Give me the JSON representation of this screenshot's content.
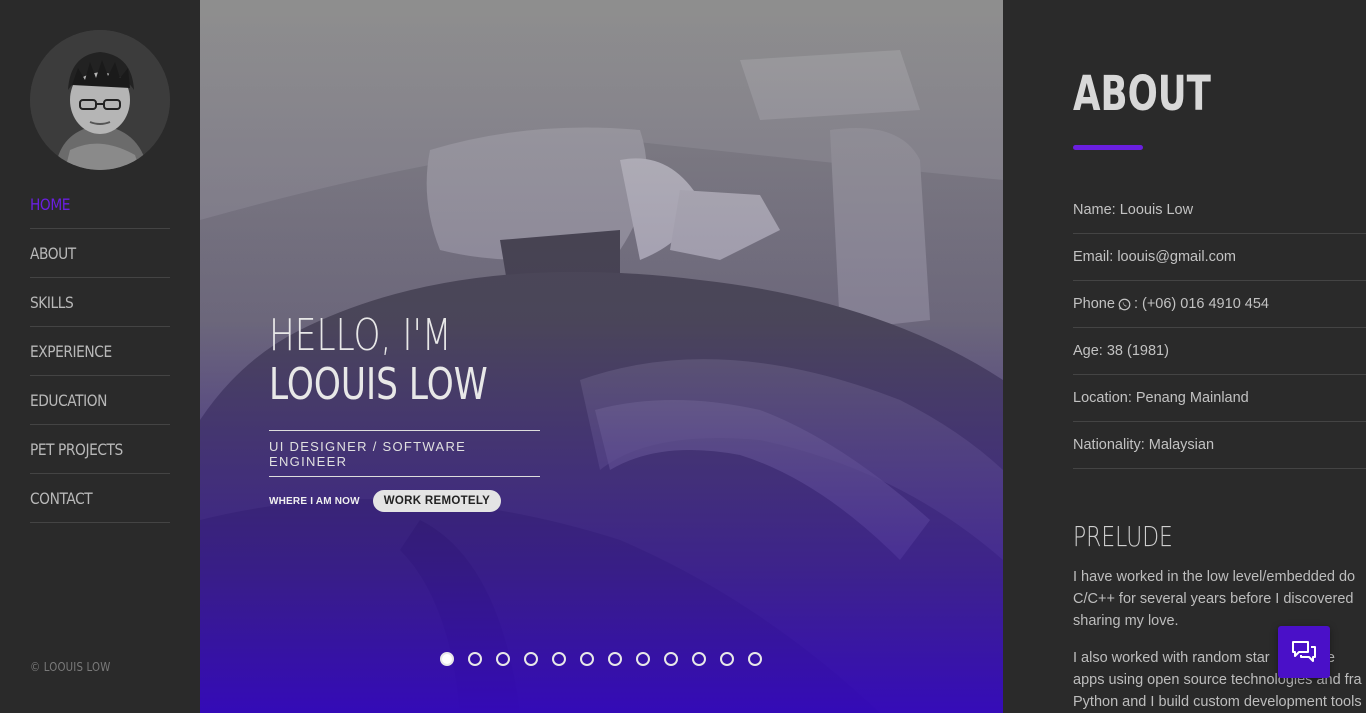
{
  "sidebar": {
    "nav": [
      "HOME",
      "ABOUT",
      "SKILLS",
      "EXPERIENCE",
      "EDUCATION",
      "PET PROJECTS",
      "CONTACT"
    ],
    "active": "HOME",
    "copyright": "© LOOUIS LOW"
  },
  "hero": {
    "greeting": "HELLO, I'M",
    "name": "LOOUIS LOW",
    "role": "UI DESIGNER / SOFTWARE ENGINEER",
    "where_label": "WHERE I AM NOW",
    "where_value": "WORK REMOTELY",
    "slide_count": 12,
    "active_slide": 1
  },
  "about": {
    "title": "ABOUT",
    "info": {
      "name": "Name: Loouis Low",
      "email": "Email: loouis@gmail.com",
      "phone_label": "Phone",
      "phone_value": ": (+06) 016 4910 454",
      "age": "Age: 38 (1981)",
      "location": "Location: Penang Mainland",
      "nationality": "Nationality: Malaysian"
    },
    "prelude_title": "PRELUDE",
    "prelude_lines_1": [
      "I have worked in the low level/embedded do",
      "C/C++ for several years before I discovered",
      "sharing my love."
    ],
    "prelude_lines_2": [
      "I also worked with random star       a free",
      "apps using open source technologies and fra",
      "Python and I build custom development tools"
    ]
  },
  "colors": {
    "accent": "#6a1fe0",
    "chat": "#4a10c8",
    "background": "#2a2a2a"
  },
  "icons": {
    "chat": "chat-icon",
    "phone": "whatsapp-icon"
  }
}
